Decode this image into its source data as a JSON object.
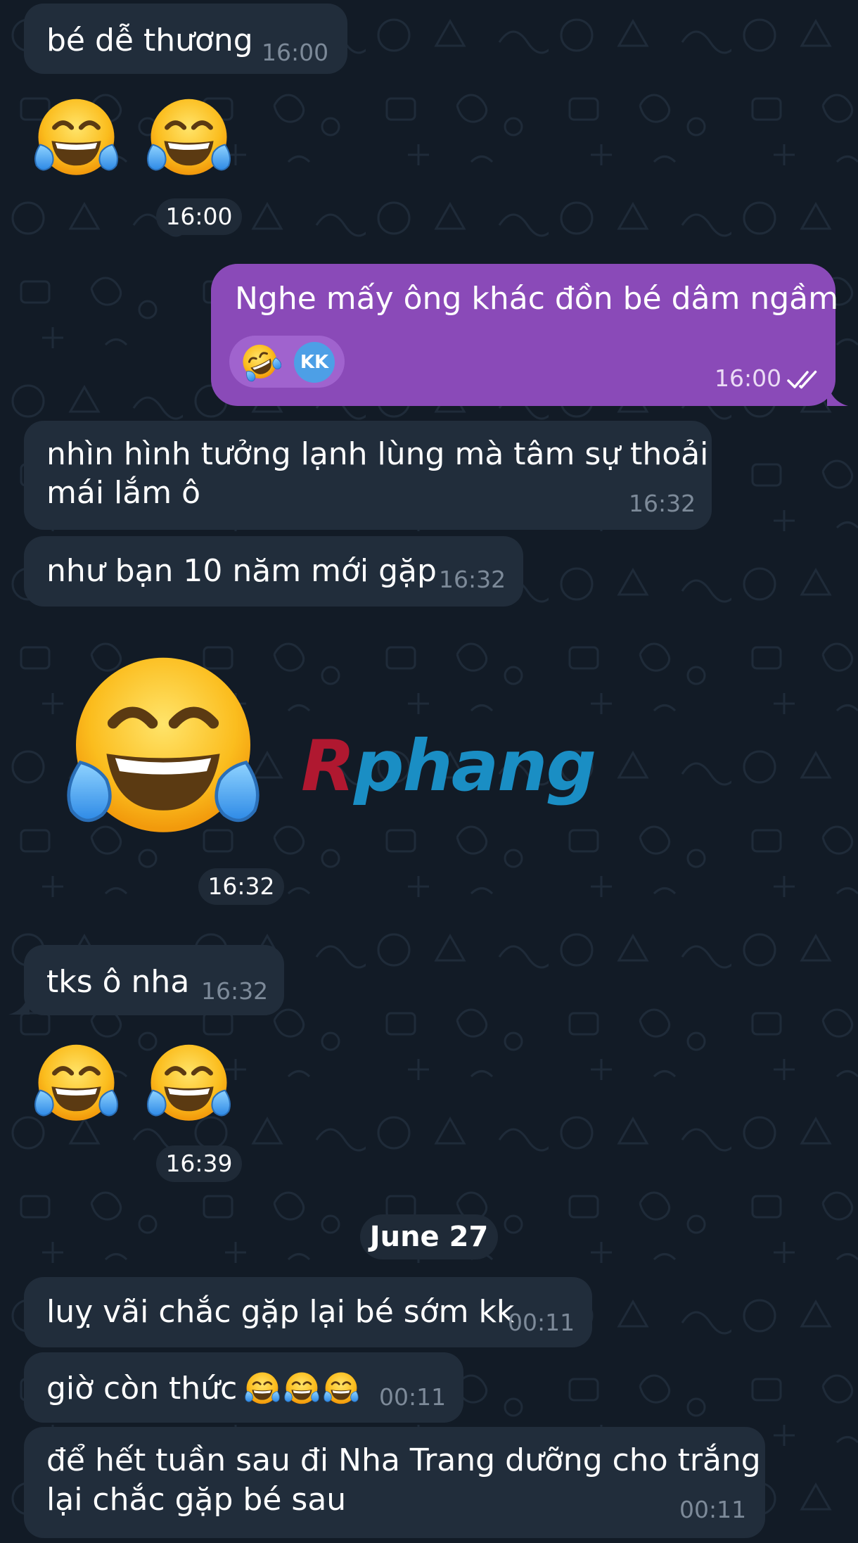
{
  "theme": {
    "background": "#121b26",
    "incoming_bubble": "#212d3b",
    "outgoing_bubble": "#8a4ab8",
    "time_color": "#7d8a99",
    "avatar_color": "#4d9fe6"
  },
  "messages": [
    {
      "text": "bé dễ thương",
      "time": "16:00"
    },
    {
      "emoji": "face-with-tears-of-joy-icon",
      "count": 2,
      "time": "16:00"
    },
    {
      "text": "Nghe mấy ông khác đồn bé dâm ngầm",
      "reaction_emoji": "rolling-on-the-floor-laughing-icon",
      "reaction_user": "KK",
      "time": "16:00"
    },
    {
      "line1": "nhìn hình tưởng lạnh lùng mà tâm sự thoải",
      "line2": "mái lắm ô",
      "time": "16:32"
    },
    {
      "text": "như bạn 10 năm mới gặp",
      "time": "16:32"
    },
    {
      "emoji": "face-with-tears-of-joy-icon",
      "count": 1,
      "time": "16:32"
    },
    {
      "text": "tks ô nha",
      "time": "16:32"
    },
    {
      "emoji": "face-with-tears-of-joy-icon",
      "count": 2,
      "time": "16:39"
    },
    {
      "text": "luỵ vãi chắc gặp lại bé sớm kk",
      "time": "00:11"
    },
    {
      "text": "giờ còn thức",
      "time": "00:11"
    },
    {
      "line1": "để hết tuần sau đi Nha Trang dưỡng cho trắng",
      "line2": "lại chắc gặp bé sau",
      "time": "00:11"
    }
  ],
  "date_separator": "June 27",
  "watermark": {
    "part1": "R",
    "part2": "phang"
  }
}
